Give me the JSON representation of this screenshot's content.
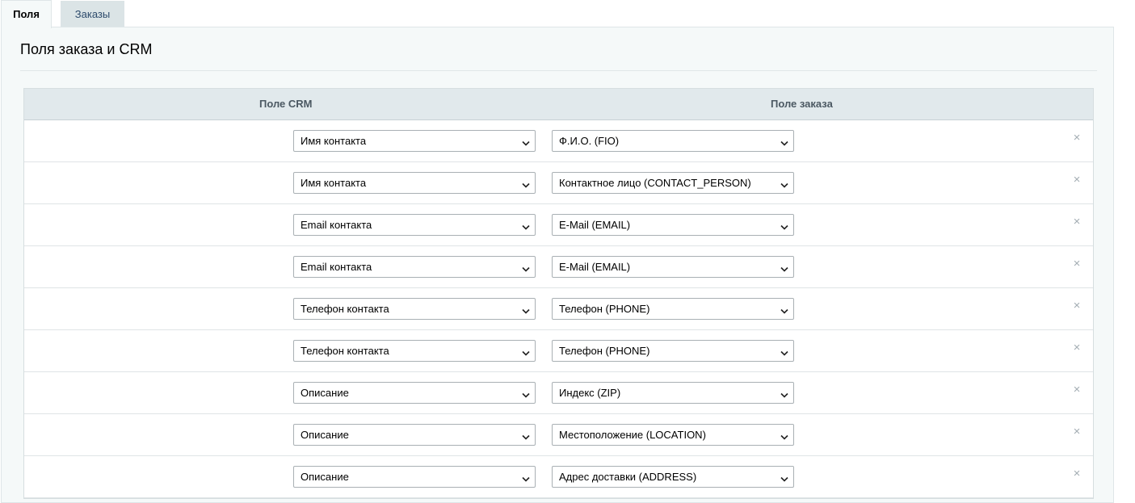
{
  "tabs": [
    {
      "label": "Поля",
      "active": true
    },
    {
      "label": "Заказы",
      "active": false
    }
  ],
  "page_title": "Поля заказа и CRM",
  "table": {
    "headers": {
      "crm": "Поле CRM",
      "order": "Поле заказа"
    },
    "rows": [
      {
        "crm": "Имя контакта",
        "order": "Ф.И.О. (FIO)"
      },
      {
        "crm": "Имя контакта",
        "order": "Контактное лицо (CONTACT_PERSON)"
      },
      {
        "crm": "Email контакта",
        "order": "E-Mail (EMAIL)"
      },
      {
        "crm": "Email контакта",
        "order": "E-Mail (EMAIL)"
      },
      {
        "crm": "Телефон контакта",
        "order": "Телефон (PHONE)"
      },
      {
        "crm": "Телефон контакта",
        "order": "Телефон (PHONE)"
      },
      {
        "crm": "Описание",
        "order": "Индекс (ZIP)"
      },
      {
        "crm": "Описание",
        "order": "Местоположение (LOCATION)"
      },
      {
        "crm": "Описание",
        "order": "Адрес доставки (ADDRESS)"
      }
    ],
    "delete_icon": "close-icon",
    "dropdown_icon": "chevron-down-icon"
  },
  "colors": {
    "panel_bg": "#f5f9f9",
    "header_bg": "#e1e9ec",
    "inactive_tab_bg": "#dbe4e6",
    "inactive_tab_text": "#2c4a6b"
  }
}
